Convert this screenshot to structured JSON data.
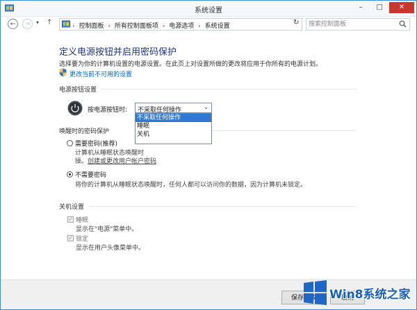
{
  "window": {
    "title": "系统设置",
    "min_label": "–",
    "max_label": "□",
    "close_label": "✕"
  },
  "address_bar": {
    "back_glyph": "←",
    "forward_glyph": "→",
    "history_glyph": "▾",
    "up_glyph": "↑",
    "path_separator": "›",
    "path": [
      "控制面板",
      "所有控制面板项",
      "电源选项",
      "系统设置"
    ],
    "dropdown_glyph": "▾",
    "refresh_glyph": "↻",
    "search_placeholder": "搜索控制面板"
  },
  "page": {
    "heading": "定义电源按钮并启用密码保护",
    "subtitle": "选择要为你的计算机设置的电源设置。在此页上对设置所做的更改将应用于你所有的电源计划。",
    "change_unavailable_link": "更改当前不可用的设置"
  },
  "power_buttons": {
    "section_title": "电源按钮设置",
    "label": "按电源按钮时:",
    "selected": "不采取任何操作",
    "options": [
      "不采取任何操作",
      "睡眠",
      "关机"
    ],
    "arrow": "⌄"
  },
  "password_protection": {
    "section_title": "唤醒时的密码保护",
    "require": {
      "label": "需要密码(推荐)",
      "desc_line1": "计算机从睡眠状态唤醒时",
      "desc_line2": "操。",
      "link": "创建或更改用户帐户密码"
    },
    "no_require": {
      "label": "不需要密码",
      "desc": "将你的计算机从睡眠状态唤醒时，任何人都可以访问你的数据，因为计算机未锁定。"
    }
  },
  "shutdown": {
    "section_title": "关机设置",
    "sleep": {
      "label": "睡眠",
      "desc": "显示在\"电源\"菜单中。",
      "checked": true
    },
    "lock": {
      "label": "锁定",
      "desc": "显示在用户头像菜单中。",
      "checked": true
    },
    "check_glyph": "✓"
  },
  "footer": {
    "save_label": "保存修改",
    "cancel_label": "取消"
  },
  "watermark": {
    "text": "Win8系统之家"
  },
  "colors": {
    "heading": "#1e3287",
    "link": "#0066cc",
    "selection": "#2f78d4",
    "close": "#c7372c",
    "border": "#3c8fd5"
  }
}
